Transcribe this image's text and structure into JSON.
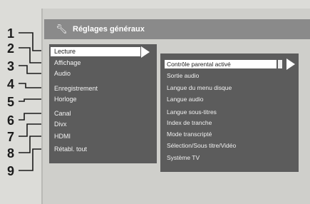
{
  "callouts": [
    "1",
    "2",
    "3",
    "4",
    "5",
    "6",
    "7",
    "8",
    "9"
  ],
  "title_bar": {
    "icon": "wrench-icon",
    "text": "Réglages généraux"
  },
  "menu": {
    "items": [
      "Lecture",
      "Affichage",
      "Audio",
      "Enregistrement",
      "Horloge",
      "Canal",
      "Divx",
      "HDMI",
      "Rétabl. tout"
    ],
    "selected_index": 0
  },
  "submenu": {
    "items": [
      "Contrôle parental activé",
      "Sortie audio",
      "Langue du menu disque",
      "Langue audio",
      "Langue sous-titres",
      "Index de tranche",
      "Mode transcripté",
      "Sélection/Sous titre/Vidéo",
      "Système TV"
    ],
    "selected_index": 0
  }
}
